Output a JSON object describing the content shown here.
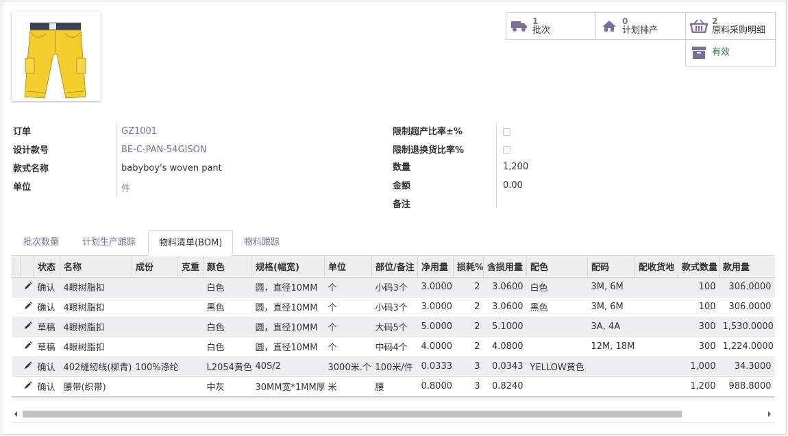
{
  "stats": {
    "batch": {
      "count": "1",
      "label": "批次"
    },
    "plan": {
      "count": "0",
      "label": "计划排产"
    },
    "purchase": {
      "count": "2",
      "label": "原料采购明细"
    },
    "status": {
      "label": "有效"
    }
  },
  "form": {
    "left": [
      {
        "label": "订单",
        "value": "GZ1001"
      },
      {
        "label": "设计款号",
        "value": "BE-C-PAN-54GISON"
      },
      {
        "label": "款式名称",
        "value": "babyboy's woven pant"
      },
      {
        "label": "单位",
        "value": "件"
      }
    ],
    "right": [
      {
        "label": "限制超产比率±%",
        "value": ""
      },
      {
        "label": "限制退换货比率%",
        "value": ""
      },
      {
        "label": "数量",
        "value": "1,200"
      },
      {
        "label": "金额",
        "value": "0.00"
      },
      {
        "label": "备注",
        "value": ""
      }
    ]
  },
  "tabs": [
    "批次数量",
    "计划生产跟踪",
    "物料清单(BOM)",
    "物料跟踪"
  ],
  "table": {
    "headers": [
      "",
      "状态",
      "名称",
      "成份",
      "克重",
      "颜色",
      "规格(幅宽)",
      "单位",
      "部位/备注",
      "净用量",
      "损耗%",
      "含损用量",
      "配色",
      "配码",
      "配收货地",
      "款式数量",
      "款用量"
    ],
    "rows": [
      [
        "",
        "确认",
        "4眼树脂扣",
        "",
        "",
        "白色",
        "圆，直径10MM",
        "个",
        "小码3个",
        "3.0000",
        "2",
        "3.0600",
        "白色",
        "3M, 6M",
        "",
        "100",
        "306.0000"
      ],
      [
        "",
        "确认",
        "4眼树脂扣",
        "",
        "",
        "黑色",
        "圆，直径10MM",
        "个",
        "小码3个",
        "3.0000",
        "2",
        "3.0600",
        "黑色",
        "3M, 6M",
        "",
        "100",
        "306.0000"
      ],
      [
        "",
        "草稿",
        "4眼树脂扣",
        "",
        "",
        "白色",
        "圆，直径10MM",
        "个",
        "大码5个",
        "5.0000",
        "2",
        "5.1000",
        "",
        "3A, 4A",
        "",
        "300",
        "1,530.0000"
      ],
      [
        "",
        "草稿",
        "4眼树脂扣",
        "",
        "",
        "白色",
        "圆，直径10MM",
        "个",
        "中码4个",
        "4.0000",
        "2",
        "4.0800",
        "",
        "12M, 18M",
        "",
        "300",
        "1,224.0000"
      ],
      [
        "",
        "确认",
        "402缝纫线(柳青)",
        "100%涤纶",
        "",
        "L2054黄色",
        "40S/2",
        "3000米.个",
        "100米/件",
        "0.0333",
        "3",
        "0.0343",
        "YELLOW黄色",
        "",
        "",
        "1,000",
        "34.3000"
      ],
      [
        "",
        "确认",
        "腰带(织带)",
        "",
        "",
        "中灰",
        "30MM宽*1MM厚",
        "米",
        "腰",
        "0.8000",
        "3",
        "0.8240",
        "",
        "",
        "",
        "1,200",
        "988.8000"
      ]
    ]
  }
}
